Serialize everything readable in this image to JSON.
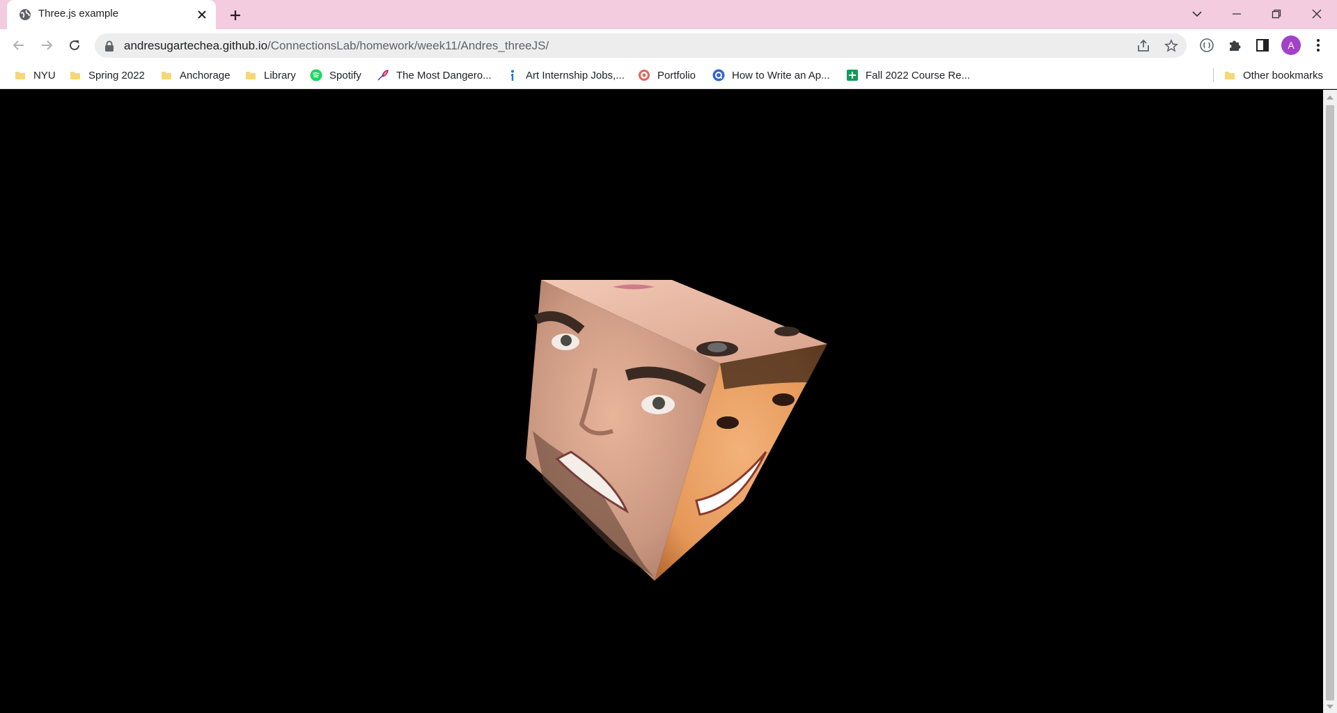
{
  "tab": {
    "title": "Three.js example",
    "favicon": "globe-icon",
    "close_icon": "close-icon"
  },
  "window_controls": [
    "tab-search-icon",
    "minimize-icon",
    "restore-icon",
    "close-window-icon"
  ],
  "toolbar": {
    "url_host": "andresugartechea.github.io",
    "url_path": "/ConnectionsLab/homework/week11/Andres_threeJS/",
    "profile_initial": "A",
    "profile_color": "#a142c9"
  },
  "bookmarks": {
    "items": [
      {
        "label": "NYU",
        "icon": "folder-icon"
      },
      {
        "label": "Spring 2022",
        "icon": "folder-icon"
      },
      {
        "label": "Anchorage",
        "icon": "folder-icon"
      },
      {
        "label": "Library",
        "icon": "folder-icon"
      },
      {
        "label": "Spotify",
        "icon": "spotify-icon"
      },
      {
        "label": "The Most Dangero...",
        "icon": "quill-icon"
      },
      {
        "label": "Art Internship Jobs,...",
        "icon": "info-pin-icon"
      },
      {
        "label": "Portfolio",
        "icon": "target-icon"
      },
      {
        "label": "How to Write an Ap...",
        "icon": "q-icon"
      },
      {
        "label": "Fall 2022 Course Re...",
        "icon": "sheets-icon"
      }
    ],
    "other": "Other bookmarks"
  },
  "page": {
    "background": "#000000",
    "scene": "rotating-textured-cube"
  }
}
